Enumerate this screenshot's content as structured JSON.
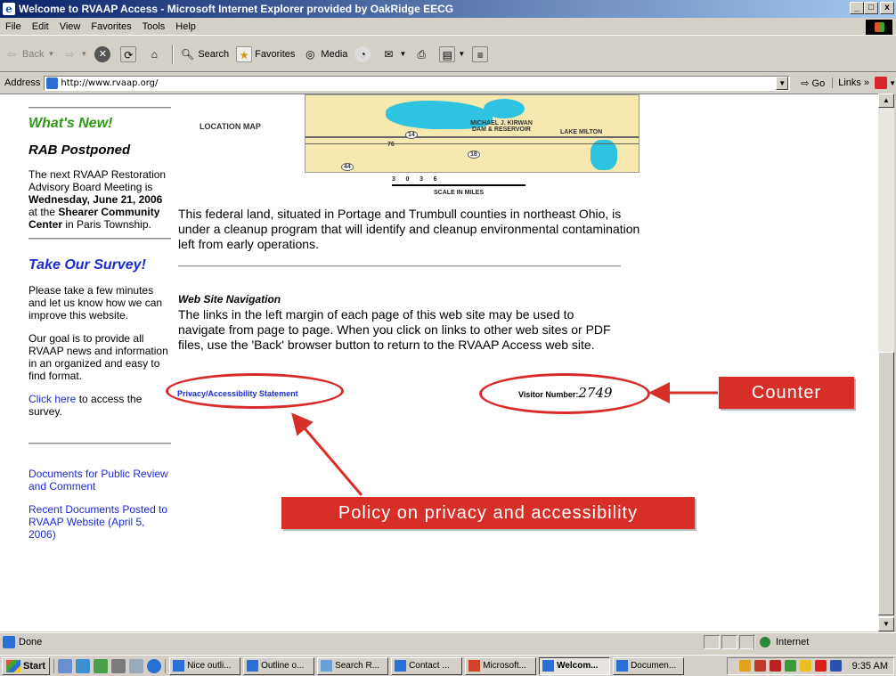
{
  "window": {
    "title": "Welcome to RVAAP Access - Microsoft Internet Explorer provided by OakRidge EECG"
  },
  "menu": [
    "File",
    "Edit",
    "View",
    "Favorites",
    "Tools",
    "Help"
  ],
  "toolbar": {
    "back": "Back",
    "search": "Search",
    "favorites": "Favorites",
    "media": "Media"
  },
  "address": {
    "label": "Address",
    "url": "http://www.rvaap.org/",
    "go": "Go",
    "links": "Links"
  },
  "sidebar": {
    "whats_new": "What's New!",
    "rab_title": "RAB Postponed",
    "rab_text_1": "The next RVAAP Restoration Advisory Board Meeting is ",
    "rab_date": "Wednesday, June 21, 2006",
    "rab_text_2": " at the ",
    "rab_place": "Shearer Community Center",
    "rab_text_3": " in Paris Township.",
    "survey_title": "Take Our Survey!",
    "survey_text": "Please take a few minutes and let us know how we can improve this website.",
    "goal_text": "Our goal is to provide all RVAAP news and information in an organized and easy to find format.",
    "click_here": "Click here",
    "click_here_rest": " to access the survey.",
    "doc_link_1": "Documents for Public Review and Comment",
    "doc_link_2": "Recent Documents Posted to RVAAP Website (April 5, 2006)"
  },
  "map": {
    "location_label": "LOCATION MAP",
    "kirwan": "MICHAEL J. KIRWAN DAM & RESERVOIR",
    "lake_milton": "LAKE MILTON",
    "route_76": "76",
    "route_14": "14",
    "route_18": "18",
    "route_44": "44",
    "scale_numbers": "3      0      3      6",
    "scale_label": "SCALE IN MILES"
  },
  "main": {
    "intro": "This federal land, situated in Portage and Trumbull counties in northeast Ohio, is under a cleanup program that will identify and cleanup environmental contamination left from early operations.",
    "nav_heading": "Web Site Navigation",
    "nav_text": "The links in the left margin of each page of this web site may be used to navigate from page to page. When you click on links to other web sites or PDF files, use the 'Back' browser button to return to the RVAAP Access web site.",
    "privacy_link": "Privacy/Accessibility Statement",
    "visitor_label": "Visitor Number:",
    "visitor_count": "2749"
  },
  "annotations": {
    "counter": "Counter",
    "policy": "Policy on privacy and accessibility",
    "color": "#d72e28"
  },
  "status": {
    "text": "Done",
    "zone": "Internet"
  },
  "taskbar": {
    "start": "Start",
    "tasks": [
      "Nice outli...",
      "Outline o...",
      "Search R...",
      "Contact ...",
      "Microsoft...",
      "Welcom...",
      "Documen..."
    ],
    "clock": "9:35 AM"
  }
}
